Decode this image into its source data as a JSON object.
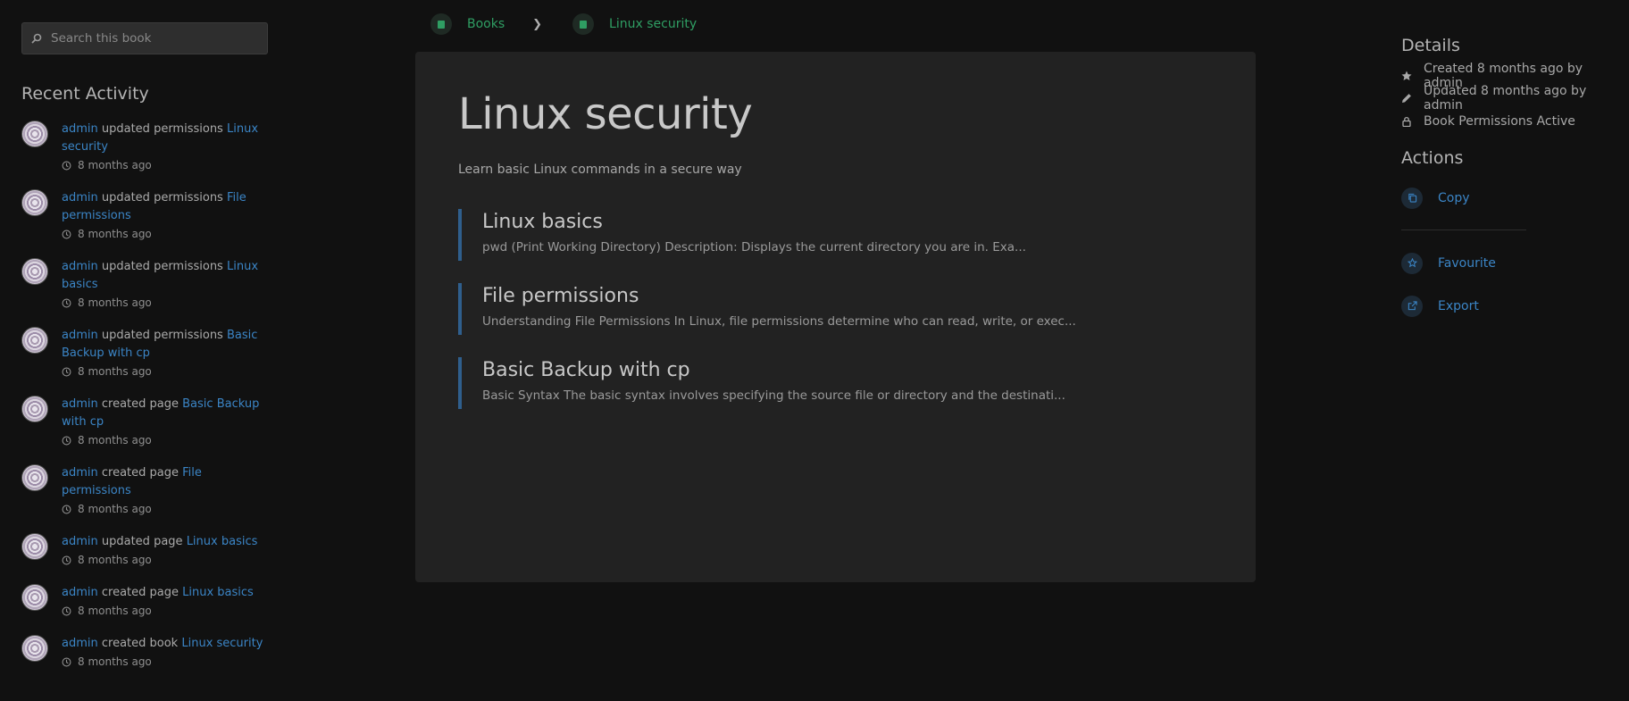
{
  "search": {
    "placeholder": "Search this book"
  },
  "recent_activity": {
    "title": "Recent Activity",
    "items": [
      {
        "user": "admin",
        "action": "updated permissions",
        "entity": "Linux security",
        "time": "8 months ago"
      },
      {
        "user": "admin",
        "action": "updated permissions",
        "entity": "File permissions",
        "time": "8 months ago"
      },
      {
        "user": "admin",
        "action": "updated permissions",
        "entity": "Linux basics",
        "time": "8 months ago"
      },
      {
        "user": "admin",
        "action": "updated permissions",
        "entity": "Basic Backup with cp",
        "time": "8 months ago"
      },
      {
        "user": "admin",
        "action": "created page",
        "entity": "Basic Backup with cp",
        "time": "8 months ago"
      },
      {
        "user": "admin",
        "action": "created page",
        "entity": "File permissions",
        "time": "8 months ago"
      },
      {
        "user": "admin",
        "action": "updated page",
        "entity": "Linux basics",
        "time": "8 months ago"
      },
      {
        "user": "admin",
        "action": "created page",
        "entity": "Linux basics",
        "time": "8 months ago"
      },
      {
        "user": "admin",
        "action": "created book",
        "entity": "Linux security",
        "time": "8 months ago"
      }
    ]
  },
  "breadcrumb": [
    {
      "label": "Books",
      "icon": "books-icon"
    },
    {
      "label": "Linux security",
      "icon": "book-icon"
    }
  ],
  "book": {
    "title": "Linux security",
    "description": "Learn basic Linux commands in a secure way",
    "pages": [
      {
        "title": "Linux basics",
        "excerpt": "pwd (Print Working Directory) Description: Displays the current directory you are in. Exa..."
      },
      {
        "title": "File permissions",
        "excerpt": "Understanding File Permissions In Linux, file permissions determine who can read, write, or exec..."
      },
      {
        "title": "Basic Backup with cp",
        "excerpt": "Basic Syntax The basic syntax involves specifying the source file or directory and the destinati..."
      }
    ]
  },
  "details": {
    "title": "Details",
    "created": "Created 8 months ago by admin",
    "updated": "Updated 8 months ago by admin",
    "permissions": "Book Permissions Active"
  },
  "actions": {
    "title": "Actions",
    "copy": "Copy",
    "favourite": "Favourite",
    "export": "Export"
  },
  "colors": {
    "background": "#111111",
    "card": "#222222",
    "link": "#3b85c6",
    "breadcrumb": "#2f9e63",
    "page_border": "#2f5f8d"
  }
}
